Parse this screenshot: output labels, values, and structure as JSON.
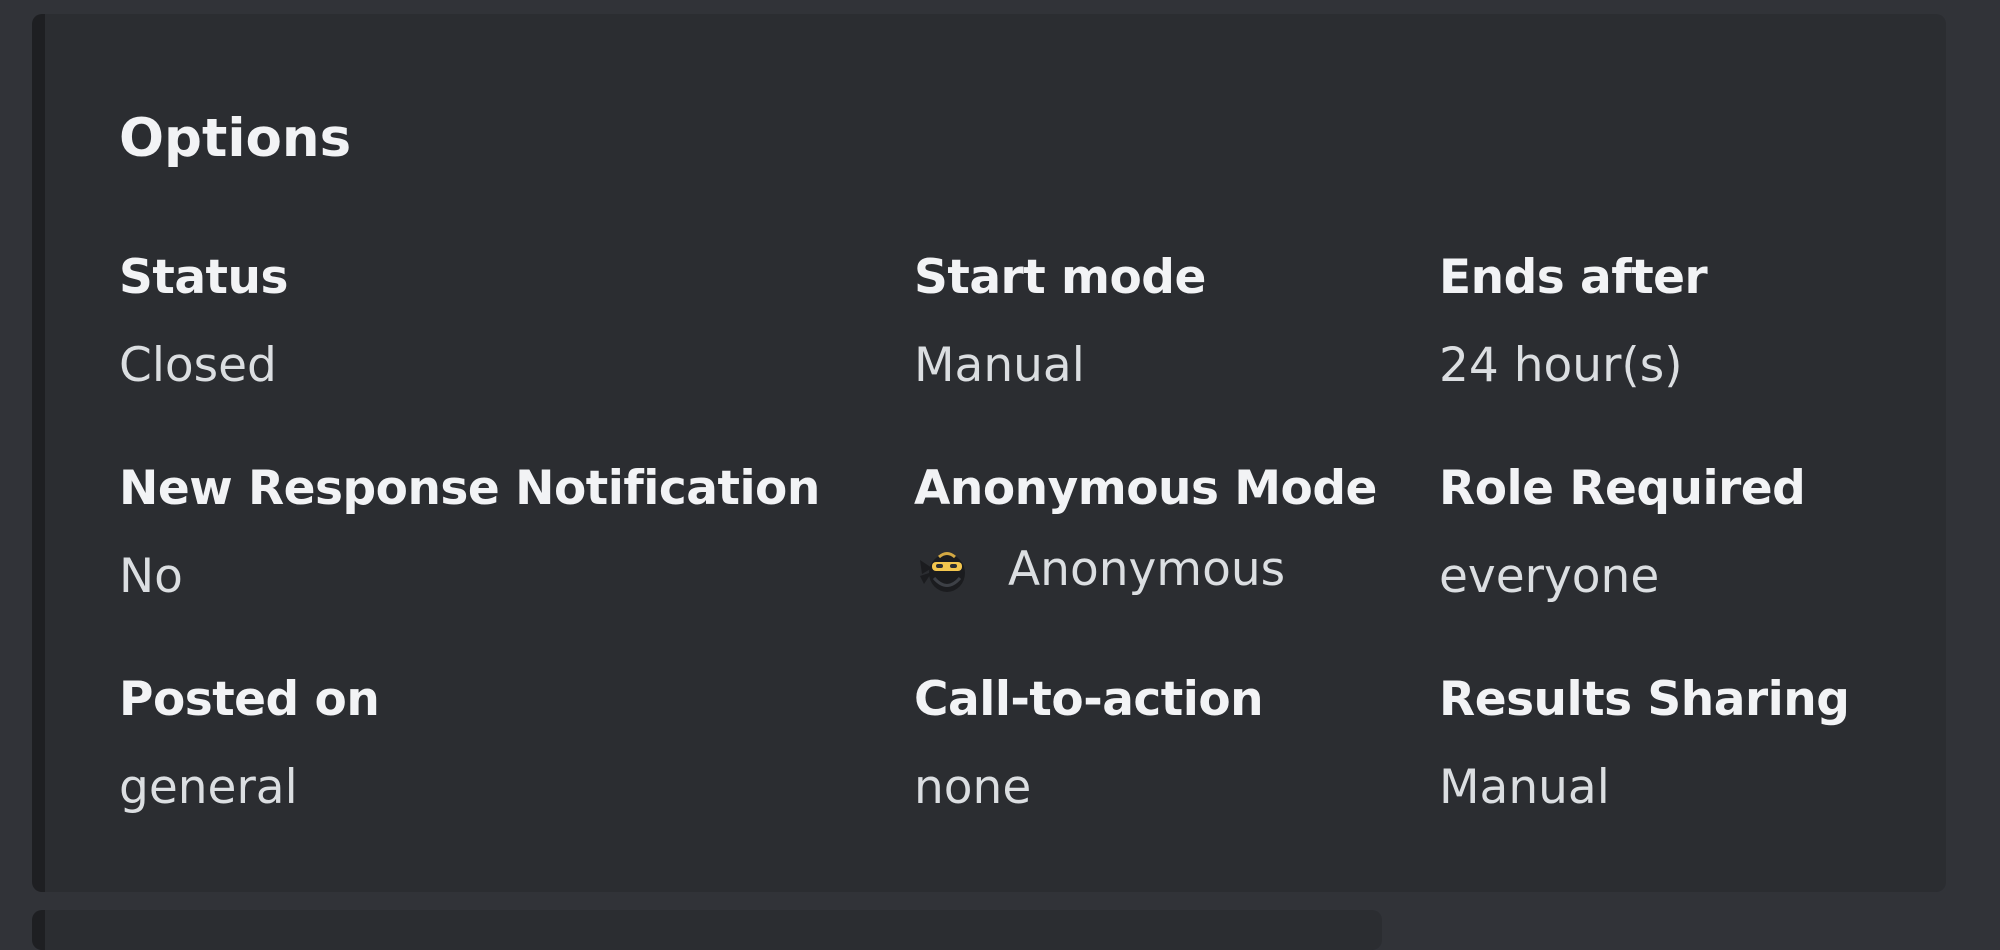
{
  "embed": {
    "title": "Options",
    "fields": [
      {
        "name": "Status",
        "value": "Closed"
      },
      {
        "name": "Start mode",
        "value": "Manual"
      },
      {
        "name": "Ends after",
        "value": "24 hour(s)"
      },
      {
        "name": "New Response Notification",
        "value": "No"
      },
      {
        "name": "Anonymous Mode",
        "value": "Anonymous",
        "icon": "anonymous-ninja-emoji-icon"
      },
      {
        "name": "Role Required",
        "value": "everyone"
      },
      {
        "name": "Posted on",
        "value": "general"
      },
      {
        "name": "Call-to-action",
        "value": "none"
      },
      {
        "name": "Results Sharing",
        "value": "Manual"
      }
    ]
  },
  "colors": {
    "background": "#313338",
    "embed_background": "#2b2d31",
    "embed_accent": "#1e1f22",
    "field_name": "#f2f3f5",
    "field_value": "#dbdee1"
  }
}
